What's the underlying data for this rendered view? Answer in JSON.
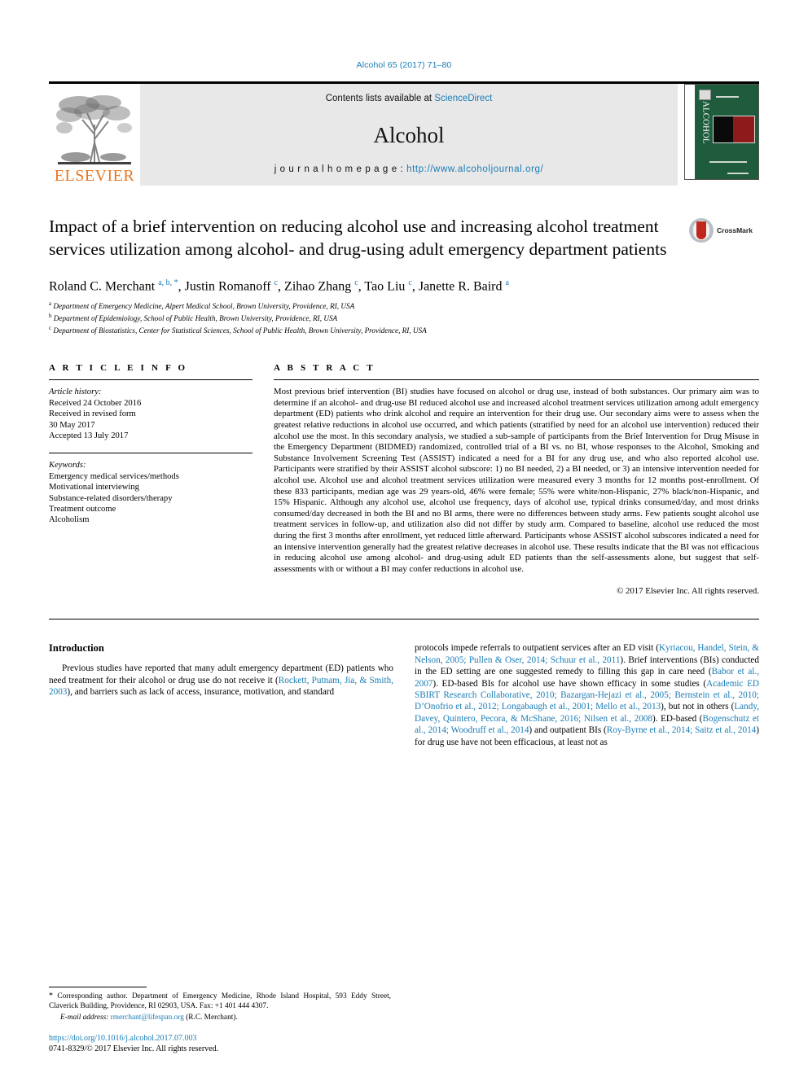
{
  "running_head": "Alcohol 65 (2017) 71–80",
  "masthead": {
    "publisher_logo_text": "ELSEVIER",
    "publisher_logo_icon": "elsevier-tree-logo",
    "contents_prefix": "Contents lists available at ",
    "contents_link": "ScienceDirect",
    "journal_name": "Alcohol",
    "homepage_prefix": "j o u r n a l   h o m e p a g e :  ",
    "homepage_url": "http://www.alcoholjournal.org/",
    "cover_title": "ALCOHOL",
    "cover_color": "#1f5c3d"
  },
  "article": {
    "title": "Impact of a brief intervention on reducing alcohol use and increasing alcohol treatment services utilization among alcohol- and drug-using adult emergency department patients",
    "crossmark_label": "CrossMark",
    "authors_html": "Roland C. Merchant <sup>a, b, *</sup>, Justin Romanoff <sup>c</sup>, Zihao Zhang <sup>c</sup>, Tao Liu <sup>c</sup>, Janette R. Baird <sup>a</sup>",
    "affiliations": [
      {
        "marker": "a",
        "text": "Department of Emergency Medicine, Alpert Medical School, Brown University, Providence, RI, USA"
      },
      {
        "marker": "b",
        "text": "Department of Epidemiology, School of Public Health, Brown University, Providence, RI, USA"
      },
      {
        "marker": "c",
        "text": "Department of Biostatistics, Center for Statistical Sciences, School of Public Health, Brown University, Providence, RI, USA"
      }
    ]
  },
  "article_info": {
    "heading": "A R T I C L E   I N F O",
    "history_label": "Article history:",
    "history_lines": [
      "Received 24 October 2016",
      "Received in revised form",
      "30 May 2017",
      "Accepted 13 July 2017"
    ],
    "keywords_label": "Keywords:",
    "keywords": [
      "Emergency medical services/methods",
      "Motivational interviewing",
      "Substance-related disorders/therapy",
      "Treatment outcome",
      "Alcoholism"
    ]
  },
  "abstract": {
    "heading": "A B S T R A C T",
    "text": "Most previous brief intervention (BI) studies have focused on alcohol or drug use, instead of both substances. Our primary aim was to determine if an alcohol- and drug-use BI reduced alcohol use and increased alcohol treatment services utilization among adult emergency department (ED) patients who drink alcohol and require an intervention for their drug use. Our secondary aims were to assess when the greatest relative reductions in alcohol use occurred, and which patients (stratified by need for an alcohol use intervention) reduced their alcohol use the most. In this secondary analysis, we studied a sub-sample of participants from the Brief Intervention for Drug Misuse in the Emergency Department (BIDMED) randomized, controlled trial of a BI vs. no BI, whose responses to the Alcohol, Smoking and Substance Involvement Screening Test (ASSIST) indicated a need for a BI for any drug use, and who also reported alcohol use. Participants were stratified by their ASSIST alcohol subscore: 1) no BI needed, 2) a BI needed, or 3) an intensive intervention needed for alcohol use. Alcohol use and alcohol treatment services utilization were measured every 3 months for 12 months post-enrollment. Of these 833 participants, median age was 29 years-old, 46% were female; 55% were white/non-Hispanic, 27% black/non-Hispanic, and 15% Hispanic. Although any alcohol use, alcohol use frequency, days of alcohol use, typical drinks consumed/day, and most drinks consumed/day decreased in both the BI and no BI arms, there were no differences between study arms. Few patients sought alcohol use treatment services in follow-up, and utilization also did not differ by study arm. Compared to baseline, alcohol use reduced the most during the first 3 months after enrollment, yet reduced little afterward. Participants whose ASSIST alcohol subscores indicated a need for an intensive intervention generally had the greatest relative decreases in alcohol use. These results indicate that the BI was not efficacious in reducing alcohol use among alcohol- and drug-using adult ED patients than the self-assessments alone, but suggest that self-assessments with or without a BI may confer reductions in alcohol use.",
    "copyright": "© 2017 Elsevier Inc. All rights reserved."
  },
  "body": {
    "section_title": "Introduction",
    "left_paragraph_html": "Previous studies have reported that many adult emergency department (ED) patients who need treatment for their alcohol or drug use do not receive it (<span class=\"cite\">Rockett, Putnam, Jia, &amp; Smith, 2003</span>), and barriers such as lack of access, insurance, motivation, and standard",
    "right_paragraph_html": "protocols impede referrals to outpatient services after an ED visit (<span class=\"cite\">Kyriacou, Handel, Stein, &amp; Nelson, 2005; Pullen &amp; Oser, 2014; Schuur et al., 2011</span>). Brief interventions (BIs) conducted in the ED setting are one suggested remedy to filling this gap in care need (<span class=\"cite\">Babor et al., 2007</span>). ED-based BIs for alcohol use have shown efficacy in some studies (<span class=\"cite\">Academic ED SBIRT Research Collaborative, 2010; Bazargan-Hejazi et al., 2005; Bernstein et al., 2010; D’Onofrio et al., 2012; Longabaugh et al., 2001; Mello et al., 2013</span>), but not in others (<span class=\"cite\">Landy, Davey, Quintero, Pecora, &amp; McShane, 2016; Nilsen et al., 2008</span>). ED-based (<span class=\"cite\">Bogenschutz et al., 2014; Woodruff et al., 2014</span>) and outpatient BIs (<span class=\"cite\">Roy-Byrne et al., 2014; Saitz et al., 2014</span>) for drug use have not been efficacious, at least not as"
  },
  "footnote": {
    "corresponding_html": "<span class=\"star\">*</span> Corresponding author. Department of Emergency Medicine, Rhode Island Hospital, 593 Eddy Street, Claverick Building, Providence, RI 02903, USA. Fax: +1 401 444 4307.",
    "email_label": "E-mail address:",
    "email": "rmerchant@lifespan.org",
    "email_suffix": "(R.C. Merchant).",
    "doi": "https://doi.org/10.1016/j.alcohol.2017.07.003",
    "issn_line": "0741-8329/© 2017 Elsevier Inc. All rights reserved."
  },
  "colors": {
    "link": "#1a7cb5",
    "elsevier_orange": "#e87722",
    "masthead_gray": "#e8e8e8"
  }
}
